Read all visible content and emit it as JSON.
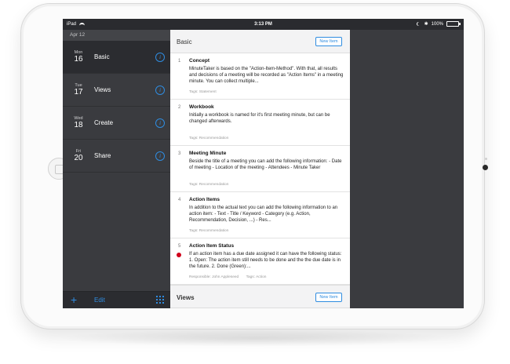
{
  "status_bar": {
    "device": "iPad",
    "time": "3:13 PM",
    "bluetooth": "✱",
    "battery": "100%",
    "battery_level": 1.0
  },
  "sidebar": {
    "header_date": "Apr 12",
    "days": [
      {
        "dow": "Mon",
        "num": "16",
        "label": "Basic",
        "selected": true
      },
      {
        "dow": "Tue",
        "num": "17",
        "label": "Views",
        "selected": false
      },
      {
        "dow": "Wed",
        "num": "18",
        "label": "Create",
        "selected": false
      },
      {
        "dow": "Fri",
        "num": "20",
        "label": "Share",
        "selected": false
      }
    ],
    "info_glyph": "i",
    "add_glyph": "+",
    "edit_label": "Edit"
  },
  "panel": {
    "section_title": "Basic",
    "new_item_label": "New Item",
    "items": [
      {
        "num": "1",
        "title": "Concept",
        "text": "MinuteTaker is based on the \"Action-Item-Method\". With that, all results and decisions of a meeting will be recorded as \"Action Items\" in a meeting minute.  You can collect multiple...",
        "tags": "Tags: Statement",
        "responsible": ""
      },
      {
        "num": "2",
        "title": "Workbook",
        "text": "Initially a workbook is named for it's first meeting minute, but can be changed afterwards.",
        "tags": "Tags: Recommendation",
        "responsible": ""
      },
      {
        "num": "3",
        "title": "Meeting Minute",
        "text": "Beside the title of a meeting you can add the following information:  - Date of meeting - Location of the meeting - Attendees - Minute Taker",
        "tags": "Tags: Recommendation",
        "responsible": ""
      },
      {
        "num": "4",
        "title": "Action Items",
        "text": "In addition to the actual text you can add the following information to an action item:  - Text - Title / Keyword - Category (e.g. Action, Recommendation, Decision, ...) - Res...",
        "tags": "Tags: Recommendation",
        "responsible": ""
      },
      {
        "num": "5",
        "title": "Action Item Status",
        "text": "If an action item has a due date assigned it can have the following status:  1. Open: The action item still needs to be done and the the due date is in the future.  2. Done (Green):...",
        "tags": "Tags: Action",
        "responsible": "Responsible: John Appleseed",
        "status_color": "#d0021b"
      }
    ],
    "next_section_title": "Views",
    "next_new_item_label": "New Item"
  },
  "colors": {
    "accent": "#2f8ce0",
    "sidebar_bg": "#3a3b3f",
    "status_red": "#d0021b",
    "battery_green": "#4cd964"
  }
}
